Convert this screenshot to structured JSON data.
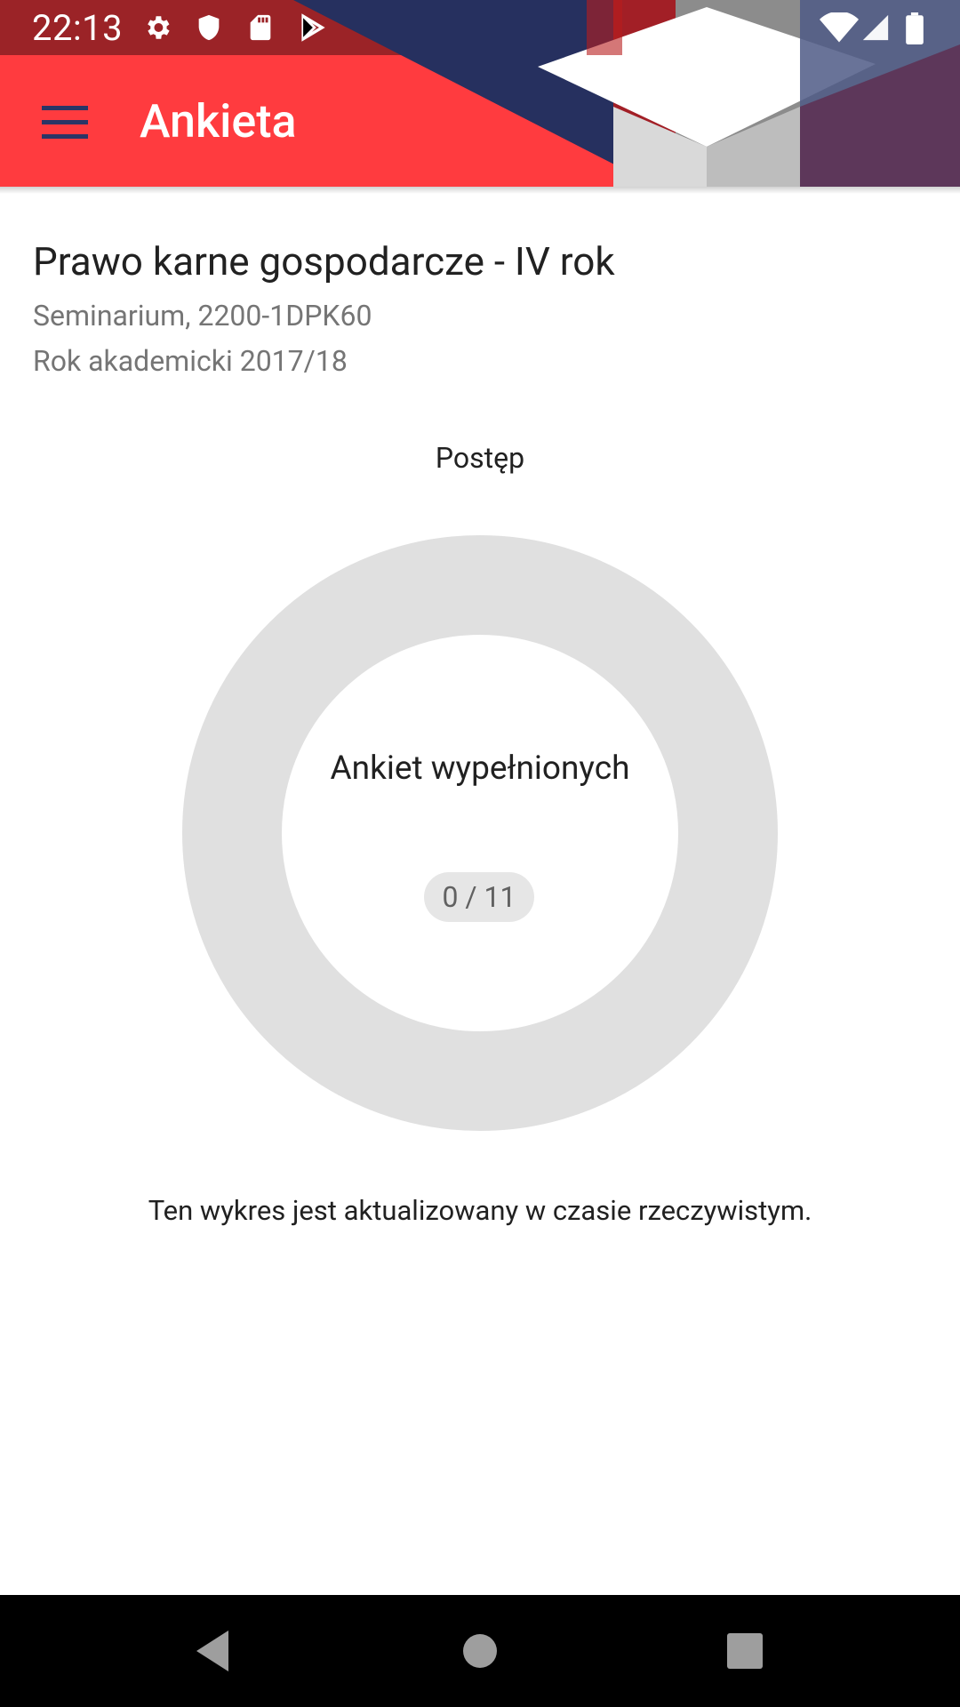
{
  "status_bar": {
    "time": "22:13",
    "icons": [
      "settings-icon",
      "shield-icon",
      "sd-card-icon",
      "play-store-icon",
      "wifi-icon",
      "signal-icon",
      "battery-icon"
    ]
  },
  "app_bar": {
    "title": "Ankieta",
    "menu_icon": "menu-icon"
  },
  "course": {
    "title": "Prawo karne gospodarcze - IV rok",
    "subtitle": "Seminarium, 2200-1DPK60",
    "academic_year": "Rok akademicki 2017/18"
  },
  "progress": {
    "heading": "Postęp",
    "center_label": "Ankiet wypełnionych",
    "count_text": "0 / 11",
    "filled": 0,
    "total": 11,
    "note": "Ten wykres jest aktualizowany w czasie rzeczywistym."
  },
  "colors": {
    "app_bar_red": "#ff3b3f",
    "navy": "#2a3566",
    "ring_track": "#e0e0e0",
    "ring_fill": "#ff3b3f"
  },
  "nav_bar": {
    "icons": [
      "back-icon",
      "home-icon",
      "recents-icon"
    ]
  }
}
